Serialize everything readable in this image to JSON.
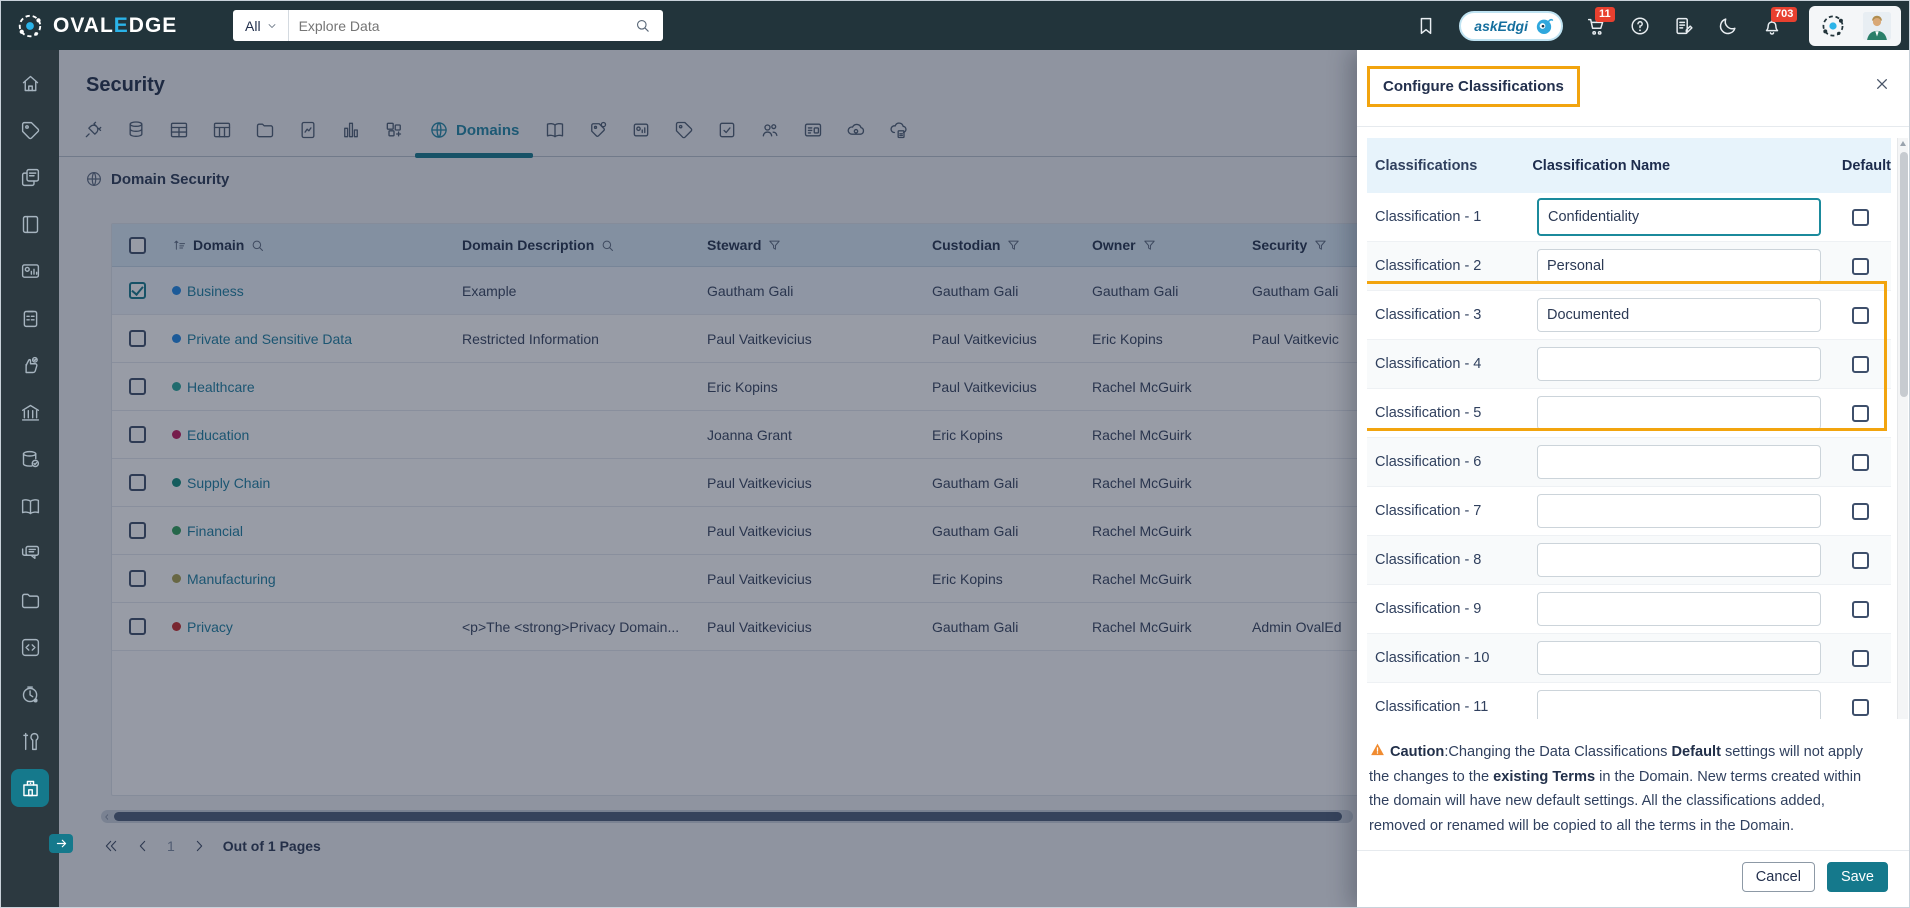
{
  "navbar": {
    "logo_part1": "OVAL",
    "logo_accent": "E",
    "logo_part2": "DGE",
    "search_scope": "All",
    "search_placeholder": "Explore Data",
    "ask_edgi_label": "askEdgi",
    "cart_badge": "11",
    "bell_badge": "703"
  },
  "sidebar": {
    "items": [
      {
        "icon": "home-icon",
        "active": false
      },
      {
        "icon": "tag-icon",
        "active": false
      },
      {
        "icon": "copy-docs-icon",
        "active": false
      },
      {
        "icon": "notebook-icon",
        "active": false
      },
      {
        "icon": "dashboard-icon",
        "active": false
      },
      {
        "icon": "clipboard-icon",
        "active": false
      },
      {
        "icon": "certify-hand-icon",
        "active": false
      },
      {
        "icon": "bank-icon",
        "active": false
      },
      {
        "icon": "database-check-icon",
        "active": false
      },
      {
        "icon": "open-book-icon",
        "active": false
      },
      {
        "icon": "chat-icon",
        "active": false
      },
      {
        "icon": "folder-icon",
        "active": false
      },
      {
        "icon": "code-icon",
        "active": false
      },
      {
        "icon": "clock-gear-icon",
        "active": false
      },
      {
        "icon": "tools-icon",
        "active": false
      },
      {
        "icon": "building-icon",
        "active": true
      }
    ]
  },
  "page": {
    "title": "Security",
    "section_title": "Domain Security"
  },
  "tabs": {
    "items": [
      {
        "icon": "plug-icon"
      },
      {
        "icon": "database-icon"
      },
      {
        "icon": "table-icon"
      },
      {
        "icon": "table-columns-icon"
      },
      {
        "icon": "folder-icon"
      },
      {
        "icon": "file-chart-icon"
      },
      {
        "icon": "bar-chart-icon"
      },
      {
        "icon": "blocks-icon"
      },
      {
        "icon": "globe-icon",
        "label": "Domains",
        "active": true
      },
      {
        "icon": "open-book-icon"
      },
      {
        "icon": "tag-badge-icon"
      },
      {
        "icon": "chart-tile-icon"
      },
      {
        "icon": "tag-icon"
      },
      {
        "icon": "doc-check-icon"
      },
      {
        "icon": "people-icon"
      },
      {
        "icon": "id-card-icon"
      },
      {
        "icon": "cloud-circle-icon"
      },
      {
        "icon": "cloud-file-icon"
      }
    ]
  },
  "domain_table": {
    "columns": {
      "domain": "Domain",
      "description": "Domain Description",
      "steward": "Steward",
      "custodian": "Custodian",
      "owner": "Owner",
      "security": "Security"
    },
    "rows": [
      {
        "domain": "Business",
        "dot": "#1e88e5",
        "checked": true,
        "description": "Example",
        "steward": "Gautham Gali",
        "custodian": "Gautham Gali",
        "owner": "Gautham Gali",
        "security": "Gautham Gali"
      },
      {
        "domain": "Private and Sensitive Data",
        "dot": "#1e88e5",
        "checked": false,
        "description": "Restricted Information",
        "steward": "Paul Vaitkevicius",
        "custodian": "Paul Vaitkevicius",
        "owner": "Eric Kopins",
        "security": "Paul Vaitkevic"
      },
      {
        "domain": "Healthcare",
        "dot": "#26a69a",
        "checked": false,
        "description": "",
        "steward": "Eric Kopins",
        "custodian": "Paul Vaitkevicius",
        "owner": "Rachel McGuirk",
        "security": ""
      },
      {
        "domain": "Education",
        "dot": "#c2185b",
        "checked": false,
        "description": "",
        "steward": "Joanna Grant",
        "custodian": "Eric Kopins",
        "owner": "Rachel McGuirk",
        "security": ""
      },
      {
        "domain": "Supply Chain",
        "dot": "#0f8b7a",
        "checked": false,
        "description": "",
        "steward": "Paul Vaitkevicius",
        "custodian": "Gautham Gali",
        "owner": "Rachel McGuirk",
        "security": ""
      },
      {
        "domain": "Financial",
        "dot": "#2e9e58",
        "checked": false,
        "description": "",
        "steward": "Paul Vaitkevicius",
        "custodian": "Gautham Gali",
        "owner": "Rachel McGuirk",
        "security": ""
      },
      {
        "domain": "Manufacturing",
        "dot": "#a89f4e",
        "checked": false,
        "description": "",
        "steward": "Paul Vaitkevicius",
        "custodian": "Eric Kopins",
        "owner": "Rachel McGuirk",
        "security": ""
      },
      {
        "domain": "Privacy",
        "dot": "#c62828",
        "checked": false,
        "description": "<p>The <strong>Privacy Domain...",
        "steward": "Paul Vaitkevicius",
        "custodian": "Gautham Gali",
        "owner": "Rachel McGuirk",
        "security": "Admin OvalEd"
      }
    ]
  },
  "pagination": {
    "current": "1",
    "label": "Out of 1 Pages"
  },
  "panel": {
    "title": "Configure Classifications",
    "columns": {
      "classifications": "Classifications",
      "name": "Classification Name",
      "default": "Default"
    },
    "rows": [
      {
        "label": "Classification - 1",
        "value": "Confidentiality",
        "focused": true,
        "highlight": true
      },
      {
        "label": "Classification - 2",
        "value": "Personal",
        "focused": false,
        "highlight": true
      },
      {
        "label": "Classification - 3",
        "value": "Documented",
        "focused": false,
        "highlight": true
      },
      {
        "label": "Classification - 4",
        "value": "",
        "focused": false,
        "highlight": false
      },
      {
        "label": "Classification - 5",
        "value": "",
        "focused": false,
        "highlight": false
      },
      {
        "label": "Classification - 6",
        "value": "",
        "focused": false,
        "highlight": false
      },
      {
        "label": "Classification - 7",
        "value": "",
        "focused": false,
        "highlight": false
      },
      {
        "label": "Classification - 8",
        "value": "",
        "focused": false,
        "highlight": false
      },
      {
        "label": "Classification - 9",
        "value": "",
        "focused": false,
        "highlight": false
      },
      {
        "label": "Classification - 10",
        "value": "",
        "focused": false,
        "highlight": false
      },
      {
        "label": "Classification - 11",
        "value": "",
        "focused": false,
        "highlight": false
      }
    ],
    "caution_segments": [
      {
        "text": "Caution",
        "bold": true
      },
      {
        "text": ":Changing the Data Classifications ",
        "bold": false
      },
      {
        "text": "Default",
        "bold": true
      },
      {
        "text": " settings will not apply the changes to the ",
        "bold": false
      },
      {
        "text": "existing Terms",
        "bold": true
      },
      {
        "text": " in the Domain. New terms created within the domain will have new default settings. All the classifications added, removed or renamed will be copied to all the terms in the Domain.",
        "bold": false
      }
    ],
    "cancel_label": "Cancel",
    "save_label": "Save"
  },
  "colors": {
    "accent_teal": "#15798c",
    "highlight_orange": "#f2a40e",
    "badge_red": "#e8402f"
  }
}
